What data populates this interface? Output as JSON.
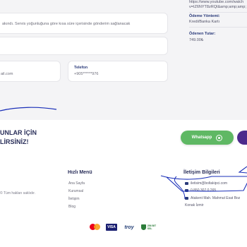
{
  "order_side": {
    "url_line1": "https://www.youtube.com/watch",
    "url_line2": "v=IZ6NYT8zRQI&amp;amp;amp;",
    "payment_method_label": "Ödeme Yöntemi:",
    "payment_method_value": "Kredi/Banka Kartı",
    "paid_amount_label": "Ödenen Tutar:",
    "paid_amount_value": "749.00₺"
  },
  "notice": {
    "text": "akındı. Servis yoğunluğuna göre kısa süre içerisinde gönderim sağlanacak"
  },
  "email_card": {
    "value": "ail.com"
  },
  "phone_card": {
    "label": "Telefon",
    "value": "+905******976"
  },
  "footer": {
    "cta_line1": "UNLAR İÇİN",
    "cta_line2": "LİRSİNİZ!",
    "whatsapp_label": "Whatsapp",
    "copyright": "© Tüm hakları saklıdır.",
    "quick_menu": {
      "title": "Hızlı Menü",
      "items": [
        "Ana Sayfa",
        "Kurumsal",
        "İletişim",
        "Blog"
      ]
    },
    "contact": {
      "title": "İletişim Bilgileri",
      "email": "iletisim@boltakipci.com",
      "phone": "0 850 307 0 265",
      "address_line1": "Atakent Mah. Mahmut Esat Boz",
      "address_line2": "Konak İzmir"
    },
    "payments": [
      "mastercard-icon",
      "visa-icon",
      "troy-icon",
      "ssl-secure-icon"
    ],
    "visa_text": "VISA",
    "troy_text": "troy",
    "ssl_text": "256 BIT SSL"
  },
  "colors": {
    "accent_navy": "#2a2f5a",
    "whatsapp_green": "#5fb864",
    "purple": "#4c2a8c",
    "annotation_blue": "#1a2fb8"
  }
}
